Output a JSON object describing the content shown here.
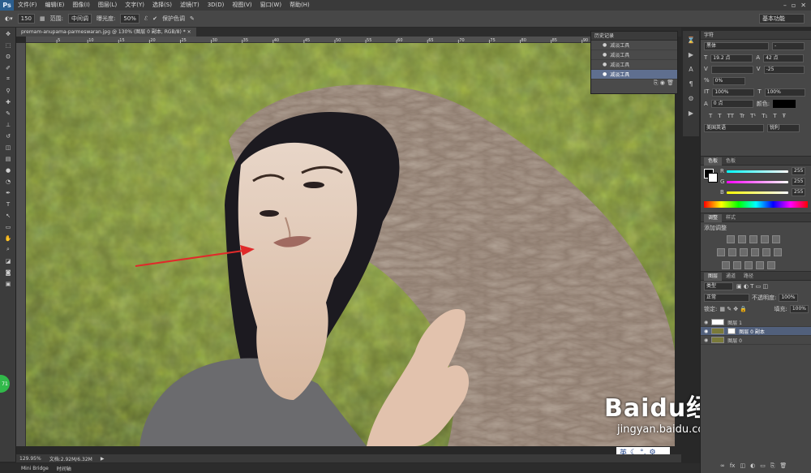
{
  "app": {
    "logo": "Ps"
  },
  "menubar": {
    "items": [
      "文件(F)",
      "编辑(E)",
      "图像(I)",
      "图层(L)",
      "文字(Y)",
      "选择(S)",
      "滤镜(T)",
      "3D(D)",
      "视图(V)",
      "窗口(W)",
      "帮助(H)"
    ]
  },
  "options": {
    "brush_size": "150",
    "range_label": "范围:",
    "range_value": "中间调",
    "exposure_label": "曝光度:",
    "exposure_value": "50%",
    "protect_label": "保护色调",
    "workspace": "基本功能"
  },
  "document": {
    "tab_title": "premam-anupama-parmeswaran.jpg @ 130% (图层 0 副本, RGB/8) *",
    "ruler_ticks": [
      "5",
      "10",
      "15",
      "20",
      "25",
      "30",
      "35",
      "40",
      "45",
      "50",
      "55",
      "60",
      "65",
      "70",
      "75",
      "80",
      "85",
      "90",
      "95",
      "100"
    ]
  },
  "status": {
    "zoom": "129.95%",
    "docinfo": "文档:2.92M/6.32M"
  },
  "bridge": {
    "tab1": "Mini Bridge",
    "tab2": "时间轴"
  },
  "history": {
    "title": "历史记录",
    "items": [
      "减淡工具",
      "减淡工具",
      "减淡工具",
      "减淡工具"
    ]
  },
  "character": {
    "tab": "字符",
    "font": "黑体",
    "size": "19.2 点",
    "leading": "42 点",
    "tracking": "-25",
    "scale_pct": "0%",
    "v_scale": "100%",
    "h_scale": "100%",
    "baseline": "0 点",
    "color_label": "颜色:",
    "language": "美国英语",
    "aa": "锐利",
    "styles": [
      "T",
      "T",
      "TT",
      "Tr",
      "T¹",
      "T₁",
      "T",
      "Ŧ"
    ]
  },
  "color_panel": {
    "tabs": [
      "色板",
      "色板"
    ],
    "r_label": "R",
    "g_label": "G",
    "b_label": "B",
    "r": "255",
    "g": "255",
    "b": "255"
  },
  "adjustments": {
    "tabs": [
      "调整",
      "样式"
    ],
    "title": "添加调整"
  },
  "layers": {
    "tabs": [
      "图层",
      "通道",
      "路径"
    ],
    "kind": "类型",
    "blend": "正常",
    "opacity_label": "不透明度:",
    "opacity": "100%",
    "lock_label": "锁定:",
    "fill_label": "填充:",
    "fill": "100%",
    "items": [
      "图层 1",
      "图层 0 副本",
      "图层 0"
    ]
  },
  "watermark": {
    "brand": "Baidu经验",
    "url": "jingyan.baidu.com"
  },
  "ime": {
    "label": "英"
  },
  "misc": {
    "badge": "71"
  }
}
